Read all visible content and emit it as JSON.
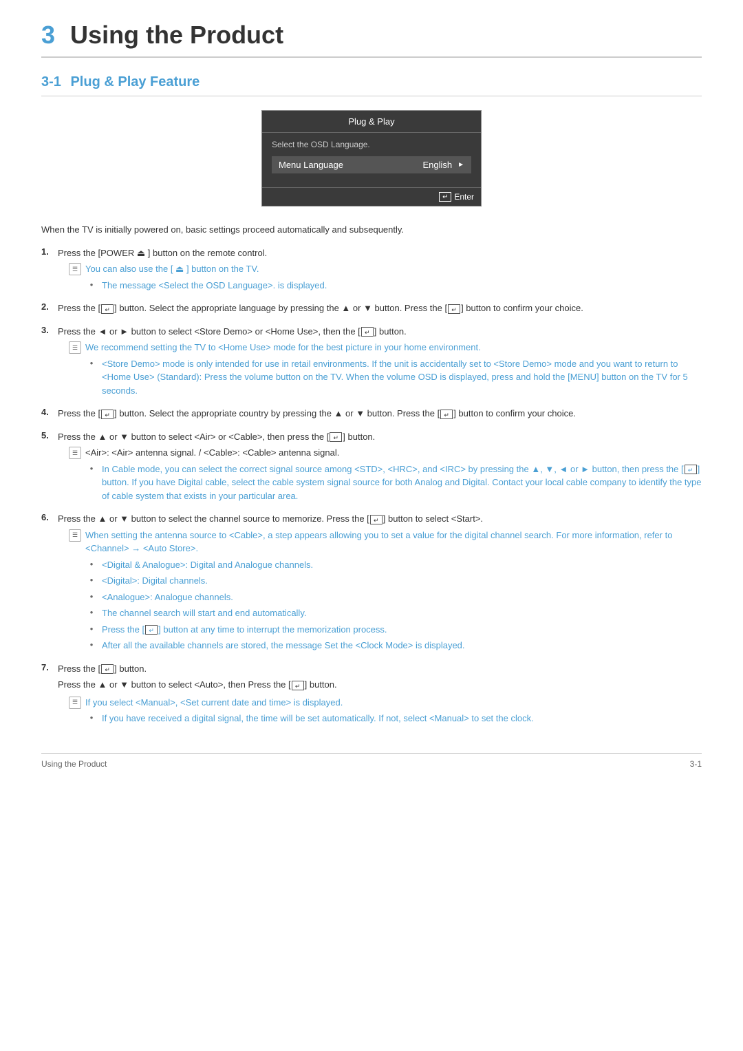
{
  "chapter": {
    "num": "3",
    "title": "Using the Product"
  },
  "section": {
    "num": "3-1",
    "title": "Plug & Play Feature"
  },
  "osd": {
    "title": "Plug & Play",
    "label": "Select the OSD Language.",
    "row_label": "Menu Language",
    "row_value": "English",
    "enter_label": "Enter"
  },
  "intro": "When the TV is initially powered on, basic settings proceed automatically and subsequently.",
  "steps": [
    {
      "num": "1.",
      "text": "Press the [POWER ⏻ ] button on the remote control.",
      "notes": [
        {
          "type": "icon",
          "level": 1,
          "text": "You can also use the [ ⏻ ] button on the TV.",
          "color": "blue"
        },
        {
          "type": "bullet",
          "level": 2,
          "text": "The message <Select the OSD Language>. is displayed.",
          "color": "blue"
        }
      ]
    },
    {
      "num": "2.",
      "text": "Press the [⏎] button. Select the appropriate language by pressing the ▲ or ▼ button. Press the [⏎] button to confirm your choice.",
      "notes": []
    },
    {
      "num": "3.",
      "text": "Press the ◄ or ► button to select <Store Demo> or <Home Use>, then the [⏎] button.",
      "notes": [
        {
          "type": "icon",
          "level": 1,
          "text": "We recommend setting the TV to <Home Use> mode for the best picture in your home environment.",
          "color": "blue"
        },
        {
          "type": "bullet",
          "level": 2,
          "text": "<Store Demo> mode is only intended for use in retail environments. If the unit is accidentally set to <Store Demo> mode and you want to return to <Home Use> (Standard): Press the volume button on the TV. When the volume OSD is displayed, press and hold the [MENU] button on the TV for 5 seconds.",
          "color": "blue"
        }
      ]
    },
    {
      "num": "4.",
      "text": "Press the [⏎] button. Select the appropriate country by pressing the ▲ or ▼ button. Press the [⏎] button to confirm your choice.",
      "notes": []
    },
    {
      "num": "5.",
      "text": "Press the ▲ or ▼ button to select <Air> or <Cable>, then press the [⏎] button.",
      "notes": [
        {
          "type": "icon",
          "level": 1,
          "text": "<Air>: <Air> antenna signal. / <Cable>: <Cable> antenna signal.",
          "color": "black"
        },
        {
          "type": "bullet",
          "level": 2,
          "text": "In Cable mode, you can select the correct signal source among <STD>, <HRC>, and <IRC> by pressing the ▲, ▼, ◄ or ► button, then press the [⏎] button. If you have Digital cable, select the cable system signal source for both Analog and Digital. Contact your local cable company to identify the type of cable system that exists in your particular area.",
          "color": "blue"
        }
      ]
    },
    {
      "num": "6.",
      "text": "Press the ▲ or ▼ button to select the channel source to memorize. Press the [⏎] button to select <Start>.",
      "notes": [
        {
          "type": "icon",
          "level": 1,
          "text": "When setting the antenna source to <Cable>, a step appears allowing you to set a value for the digital channel search. For more information, refer to <Channel> → <Auto Store>.",
          "color": "blue"
        },
        {
          "type": "bullet",
          "level": 2,
          "text": "<Digital & Analogue>: Digital and Analogue channels.",
          "color": "blue"
        },
        {
          "type": "bullet",
          "level": 2,
          "text": "<Digital>: Digital channels.",
          "color": "blue"
        },
        {
          "type": "bullet",
          "level": 2,
          "text": "<Analogue>: Analogue channels.",
          "color": "blue"
        },
        {
          "type": "bullet",
          "level": 2,
          "text": "The channel search will start and end automatically.",
          "color": "blue"
        },
        {
          "type": "bullet",
          "level": 2,
          "text": "Press the [⏎] button at any time to interrupt the memorization process.",
          "color": "blue"
        },
        {
          "type": "bullet",
          "level": 2,
          "text": "After all the available channels are stored, the message Set the <Clock Mode> is displayed.",
          "color": "blue"
        }
      ]
    },
    {
      "num": "7.",
      "text": "Press the [⏎] button.",
      "sub_text": "Press the ▲ or ▼ button to select <Auto>, then Press the [⏎] button.",
      "notes": [
        {
          "type": "icon",
          "level": 1,
          "text": "If you select <Manual>, <Set current date and time> is displayed.",
          "color": "blue"
        },
        {
          "type": "bullet",
          "level": 2,
          "text": "If you have received a digital signal, the time will be set automatically. If not, select <Manual> to set the clock.",
          "color": "blue"
        }
      ]
    }
  ],
  "footer": {
    "left": "Using the Product",
    "right": "3-1"
  }
}
